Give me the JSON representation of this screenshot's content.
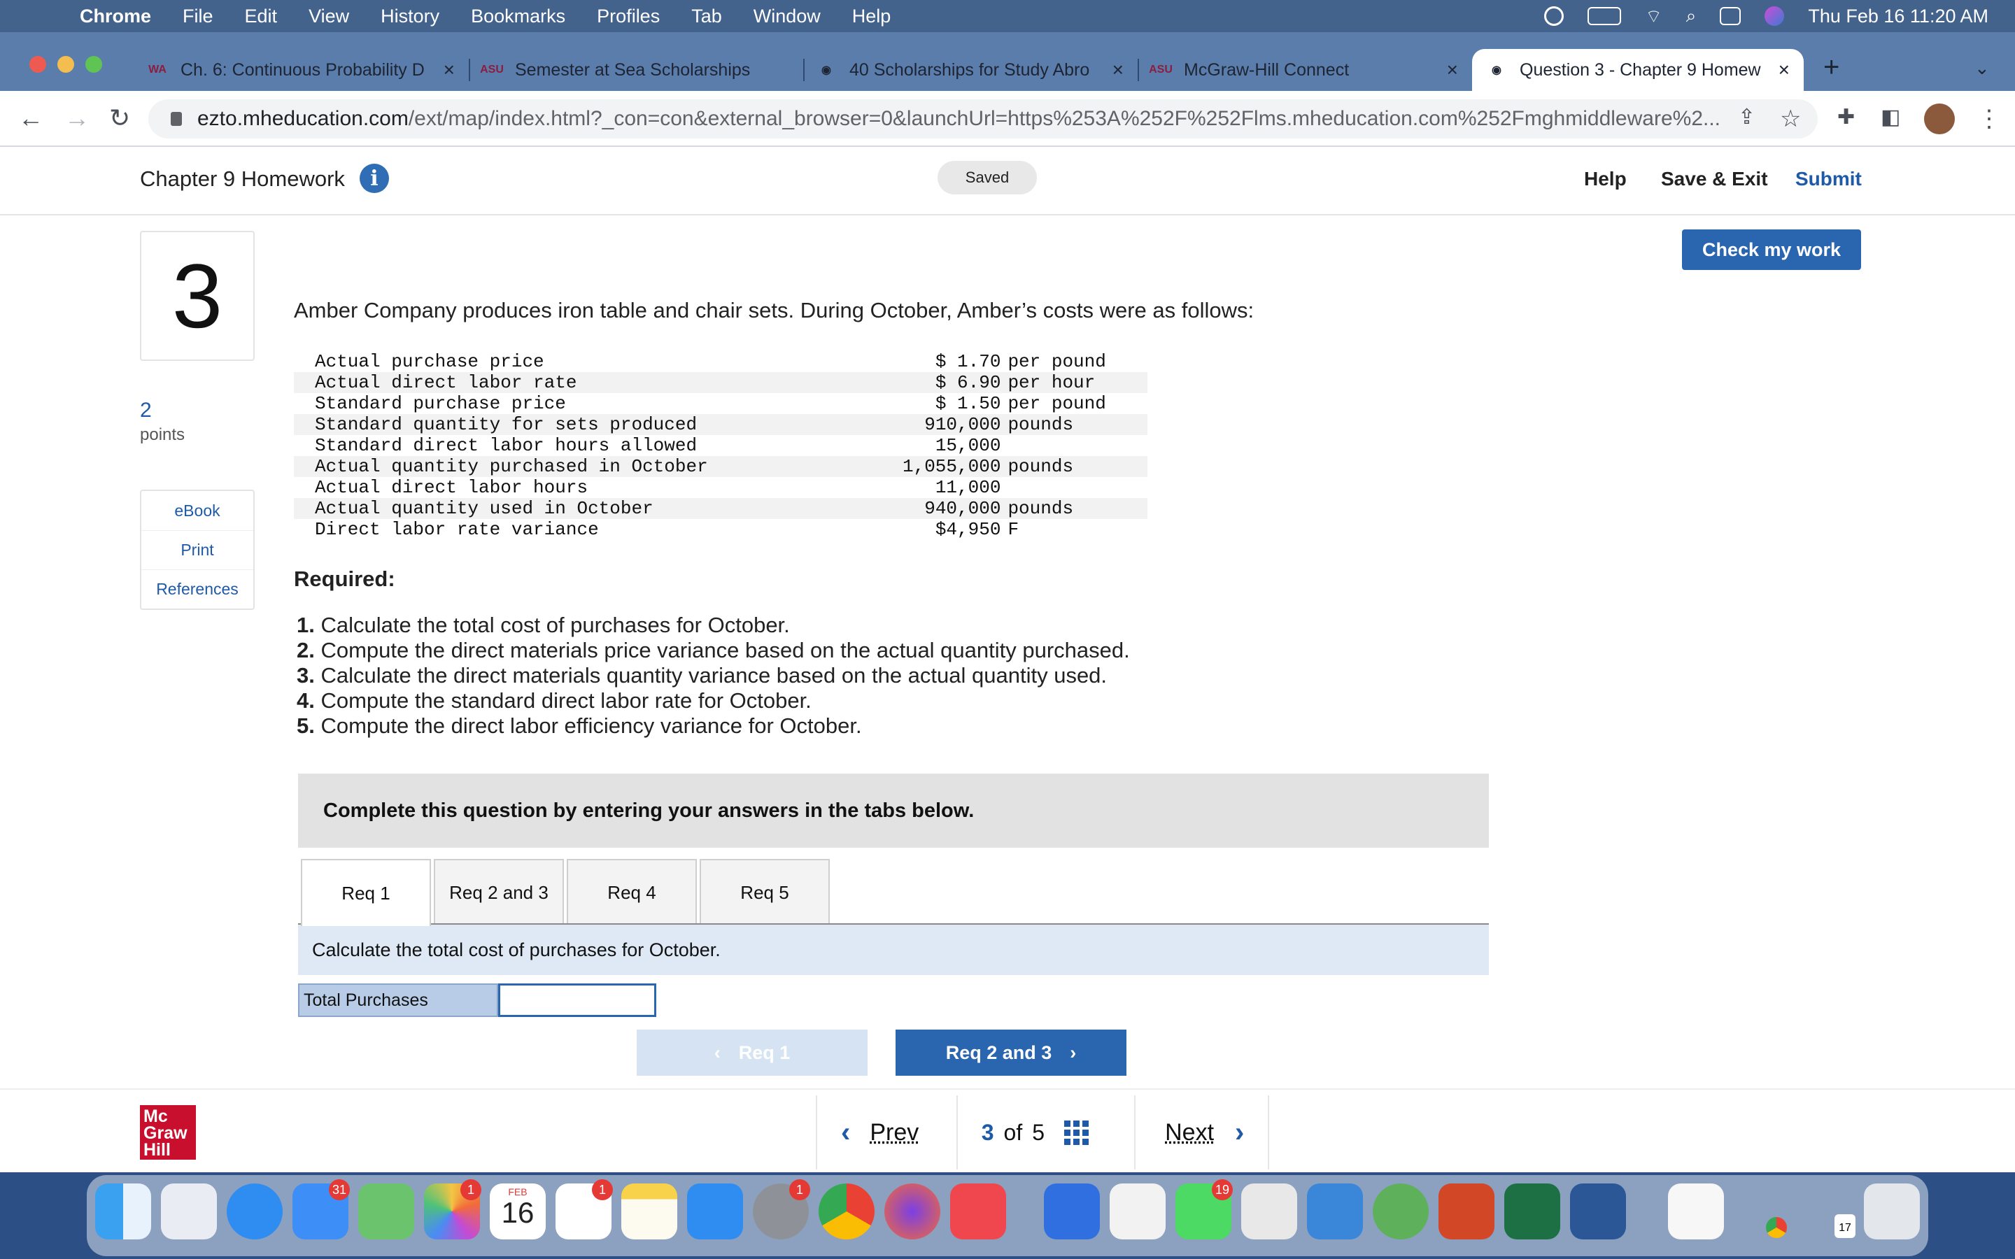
{
  "menubar": {
    "items": [
      "Chrome",
      "File",
      "Edit",
      "View",
      "History",
      "Bookmarks",
      "Profiles",
      "Tab",
      "Window",
      "Help"
    ],
    "datetime": "Thu Feb 16  11:20 AM"
  },
  "tabs": [
    {
      "favicon": "wa-icon",
      "title": "Ch. 6: Continuous Probability D"
    },
    {
      "favicon": "asu-icon",
      "title": "Semester at Sea Scholarships"
    },
    {
      "favicon": "globe-icon",
      "title": "40 Scholarships for Study Abro"
    },
    {
      "favicon": "asu-icon",
      "title": "McGraw-Hill Connect"
    },
    {
      "favicon": "globe-icon",
      "title": "Question 3 - Chapter 9 Homew"
    }
  ],
  "url": {
    "host": "ezto.mheducation.com",
    "path": "/ext/map/index.html?_con=con&external_browser=0&launchUrl=https%253A%252F%252Flms.mheducation.com%252Fmghmiddleware%2..."
  },
  "header": {
    "title": "Chapter 9 Homework",
    "info_glyph": "i",
    "saved": "Saved",
    "help": "Help",
    "save_exit": "Save & Exit",
    "submit": "Submit"
  },
  "question": {
    "number": "3",
    "points": "2",
    "points_label": "points",
    "side_links": [
      "eBook",
      "Print",
      "References"
    ],
    "check_button": "Check my work",
    "text": "Amber Company produces iron table and chair sets. During October, Amber’s costs were as follows:",
    "rows": [
      {
        "label": "Actual purchase price",
        "value": "$ 1.70",
        "unit": "per pound"
      },
      {
        "label": "Actual direct labor rate",
        "value": "$ 6.90",
        "unit": "per hour"
      },
      {
        "label": "Standard purchase price",
        "value": "$ 1.50",
        "unit": "per pound"
      },
      {
        "label": "Standard quantity for sets produced",
        "value": "910,000",
        "unit": "pounds"
      },
      {
        "label": "Standard direct labor hours allowed",
        "value": "15,000",
        "unit": ""
      },
      {
        "label": "Actual quantity purchased in October",
        "value": "1,055,000",
        "unit": "pounds"
      },
      {
        "label": "Actual direct labor hours",
        "value": "11,000",
        "unit": ""
      },
      {
        "label": "Actual quantity used in October",
        "value": "940,000",
        "unit": "pounds"
      },
      {
        "label": "Direct labor rate variance",
        "value": "$4,950",
        "unit": "F"
      }
    ],
    "required_label": "Required:",
    "required": [
      {
        "n": "1.",
        "text": "Calculate the total cost of purchases for October."
      },
      {
        "n": "2.",
        "text": "Compute the direct materials price variance based on the actual quantity purchased."
      },
      {
        "n": "3.",
        "text": "Calculate the direct materials quantity variance based on the actual quantity used."
      },
      {
        "n": "4.",
        "text": "Compute the standard direct labor rate for October."
      },
      {
        "n": "5.",
        "text": "Compute the direct labor efficiency variance for October."
      }
    ],
    "complete_instruction": "Complete this question by entering your answers in the tabs below.",
    "req_tabs": [
      "Req 1",
      "Req 2 and 3",
      "Req 4",
      "Req 5"
    ],
    "active_tab": "Req 1",
    "tab_instruction": "Calculate the total cost of purchases for October.",
    "answer_label": "Total Purchases",
    "answer_value": "",
    "prev_req": "Req 1",
    "next_req": "Req 2 and 3"
  },
  "footer": {
    "logo_lines": [
      "Mc",
      "Graw",
      "Hill"
    ],
    "prev": "Prev",
    "current": "3",
    "of": "of",
    "total": "5",
    "next": "Next"
  },
  "dock": {
    "mail_badge": "31",
    "photos_badge": "1",
    "calendar_month": "FEB",
    "calendar_day": "16",
    "reminders_badge": "1",
    "settings_badge": "1",
    "messages_badge": "19",
    "mini_calendar_day": "17"
  },
  "colors": {
    "menubar": "#43638c",
    "tabstrip": "#5b7dab",
    "accent_blue": "#2a65b0",
    "mh_red": "#c8102e"
  }
}
